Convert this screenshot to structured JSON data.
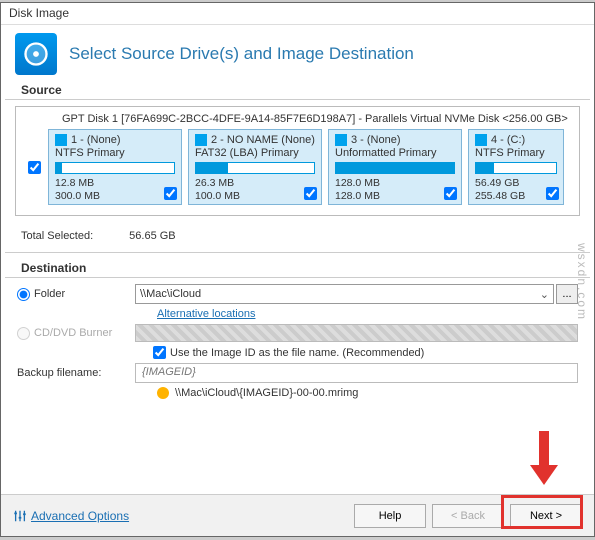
{
  "window_title": "Disk Image",
  "main_heading": "Select Source Drive(s) and Image Destination",
  "source_heading": "Source",
  "gpt_line": "GPT Disk 1 [76FA699C-2BCC-4DFE-9A14-85F7E6D198A7] - Parallels Virtual NVMe Disk  <256.00 GB>",
  "partitions": [
    {
      "num": "1 - (None)",
      "fs": "NTFS Primary",
      "used": "12.8 MB",
      "total": "300.0 MB",
      "fill": 5
    },
    {
      "num": "2 - NO NAME (None)",
      "fs": "FAT32 (LBA) Primary",
      "used": "26.3 MB",
      "total": "100.0 MB",
      "fill": 27
    },
    {
      "num": "3 - (None)",
      "fs": "Unformatted Primary",
      "used": "128.0 MB",
      "total": "128.0 MB",
      "fill": 100
    },
    {
      "num": "4 - (C:)",
      "fs": "NTFS Primary",
      "used": "56.49 GB",
      "total": "255.48 GB",
      "fill": 22
    }
  ],
  "totals": {
    "label": "Total Selected:",
    "value": "56.65 GB"
  },
  "destination_heading": "Destination",
  "folder_label": "Folder",
  "folder_value": "\\\\Mac\\iCloud",
  "browse_label": "...",
  "alt_locations": "Alternative locations",
  "cd_label": "CD/DVD Burner",
  "imageid_checkbox": "Use the Image ID as the file name.   (Recommended)",
  "backup_label": "Backup filename:",
  "backup_value": "{IMAGEID}",
  "path_preview": "\\\\Mac\\iCloud\\{IMAGEID}-00-00.mrimg",
  "advanced": "Advanced Options",
  "buttons": {
    "help": "Help",
    "back": "< Back",
    "next": "Next >"
  },
  "watermark": "wsxdn.com"
}
